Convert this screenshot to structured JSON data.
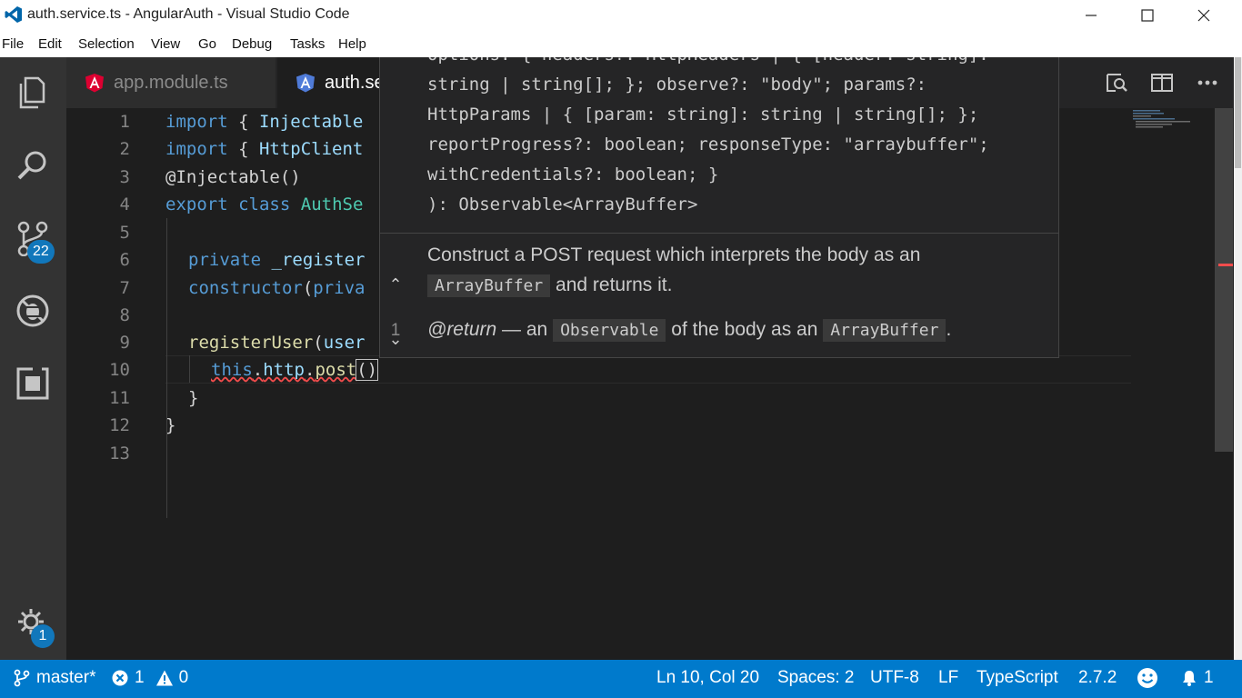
{
  "window": {
    "title": "auth.service.ts - AngularAuth - Visual Studio Code"
  },
  "menu": [
    "File",
    "Edit",
    "Selection",
    "View",
    "Go",
    "Debug",
    "Tasks",
    "Help"
  ],
  "activity_bar": {
    "scm_badge": "22",
    "settings_badge": "1"
  },
  "tabs": [
    {
      "label": "app.module.ts",
      "active": false
    },
    {
      "label": "auth.se",
      "active": true
    }
  ],
  "editor": {
    "line_numbers": [
      "1",
      "2",
      "3",
      "4",
      "5",
      "6",
      "7",
      "8",
      "9",
      "10",
      "11",
      "12",
      "13"
    ],
    "lines": {
      "l1": {
        "kw": "import",
        "rest": " { ",
        "ident": "Injectable"
      },
      "l2": {
        "kw": "import",
        "rest": " { ",
        "ident": "HttpClient"
      },
      "l3": {
        "text": "@Injectable()"
      },
      "l4": {
        "kw1": "export",
        "kw2": "class",
        "ident": "AuthSe"
      },
      "l6": {
        "kw": "private",
        "ident": "_register"
      },
      "l7": {
        "kw": "constructor",
        "rest": "(",
        "ident": "priva"
      },
      "l9": {
        "fn": "registerUser",
        "rest": "(",
        "ident": "user"
      },
      "l10": {
        "this": "this",
        "dot1": ".",
        "prop": "http",
        "dot2": ".",
        "fn": "post",
        "open": "(",
        "close": ")"
      },
      "l11": {
        "text": "}"
      },
      "l12": {
        "text": "}"
      }
    }
  },
  "parameter_hints": {
    "nav_up": "⌃",
    "nav_count": "1",
    "nav_down": "⌄",
    "signature_lines": [
      "options: { headers?: HttpHeaders | { [header: string]:",
      "string | string[]; }; observe?: \"body\"; params?:",
      "HttpParams | { [param: string]: string | string[]; };",
      "reportProgress?: boolean; responseType: \"arraybuffer\";",
      "withCredentials?: boolean; }",
      "): Observable<ArrayBuffer>"
    ],
    "doc_line1": "Construct a POST request which interprets the body as an",
    "doc_code1": "ArrayBuffer",
    "doc_line2_rest": " and returns it.",
    "return_tag": "@return",
    "return_dash": " — an ",
    "return_code1": "Observable",
    "return_mid": " of the body as an ",
    "return_code2": "ArrayBuffer",
    "return_end": "."
  },
  "status_bar": {
    "branch": "master*",
    "errors": "1",
    "warnings": "0",
    "position": "Ln 10, Col 20",
    "spaces": "Spaces: 2",
    "encoding": "UTF-8",
    "eol": "LF",
    "language": "TypeScript",
    "version": "2.7.2",
    "notifications": "1"
  },
  "colors": {
    "status_bar": "#007acc",
    "activity_bar": "#333333",
    "editor_bg": "#1e1e1e",
    "keyword": "#569cd6",
    "type": "#4ec9b0",
    "error": "#f14c4c"
  }
}
